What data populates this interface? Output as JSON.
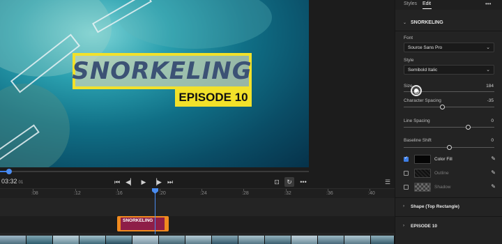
{
  "video": {
    "title_text": "SNORKELING",
    "episode_text": "EPISODE 10"
  },
  "transport": {
    "timecode": "03:32",
    "timecode_frames": "01",
    "loop_active": true
  },
  "timeline": {
    "ruler_ticks": [
      ":08",
      ":12",
      ":16",
      ":20",
      ":24",
      ":28",
      ":32",
      ":36",
      ":40"
    ],
    "title_clip_label": "SNORKELING",
    "clip_color": "#8e1e48",
    "clip_border_color": "#f08a1f",
    "playhead_color": "#4a8cf0"
  },
  "panel": {
    "tabs": [
      "Styles",
      "Edit"
    ],
    "active_tab": "Edit",
    "section_title": "SNORKELING",
    "font_label": "Font",
    "font_value": "Source Sans Pro",
    "style_label": "Style",
    "style_value": "Semibold Italic",
    "sliders": [
      {
        "label": "Size",
        "value": "184",
        "fraction": 0.12
      },
      {
        "label": "Character Spacing",
        "value": "-35",
        "fraction": 0.42
      },
      {
        "label": "Line Spacing",
        "value": "0",
        "fraction": 0.72
      },
      {
        "label": "Baseline Shift",
        "value": "0",
        "fraction": 0.5
      }
    ],
    "fills": [
      {
        "label": "Color Fill",
        "checked": true,
        "swatch": "solid-black"
      },
      {
        "label": "Outline",
        "checked": false,
        "swatch": "pattern-dark"
      },
      {
        "label": "Shadow",
        "checked": false,
        "swatch": "checker"
      }
    ],
    "collapsed_sections": [
      "Shape (Top Rectangle)",
      "EPISODE 10"
    ]
  }
}
